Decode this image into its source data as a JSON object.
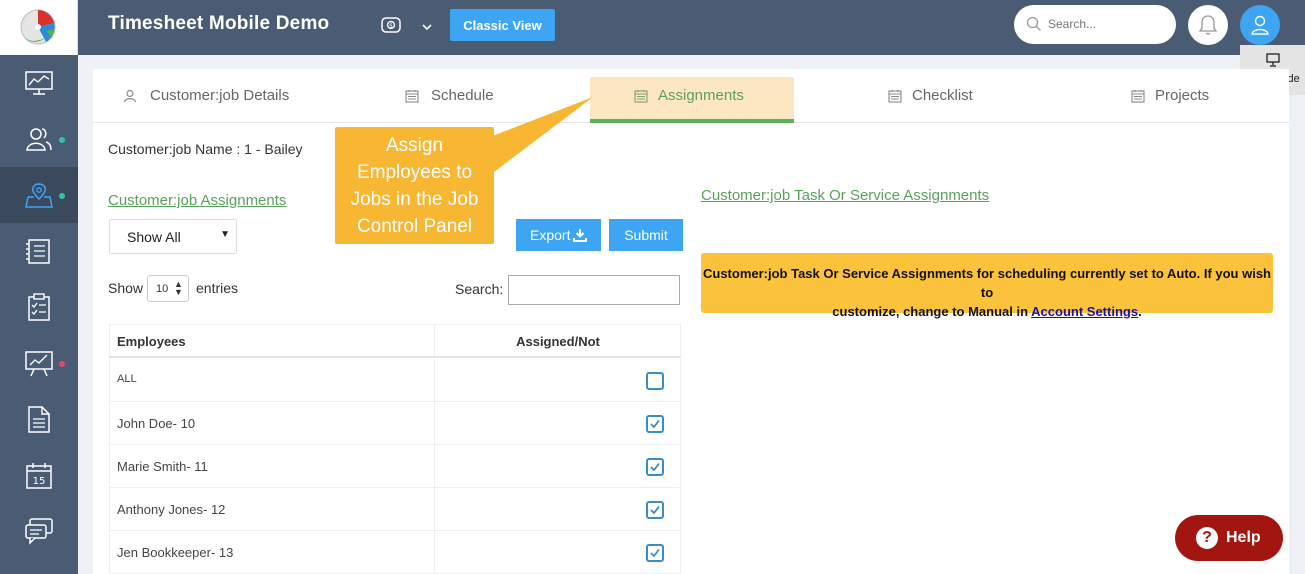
{
  "app": {
    "title": "Timesheet Mobile Demo",
    "classic_view_label": "Classic View",
    "search_placeholder": "Search...",
    "page_guide_label": "page guide",
    "help_label": "Help"
  },
  "sidebar": {
    "items": [
      {
        "icon": "dashboard-monitor-icon",
        "active": false,
        "dot": null
      },
      {
        "icon": "users-icon",
        "active": false,
        "dot": "#2ec4a6"
      },
      {
        "icon": "map-pin-icon",
        "active": true,
        "dot": "#2ec4a6"
      },
      {
        "icon": "timesheet-icon",
        "active": false,
        "dot": null
      },
      {
        "icon": "clipboard-checklist-icon",
        "active": false,
        "dot": null
      },
      {
        "icon": "chart-presentation-icon",
        "active": false,
        "dot": "#e9456b"
      },
      {
        "icon": "document-icon",
        "active": false,
        "dot": null
      },
      {
        "icon": "calendar-icon",
        "active": false,
        "dot": null
      },
      {
        "icon": "chat-icon",
        "active": false,
        "dot": null
      }
    ]
  },
  "tabs": [
    {
      "label": "Customer:job Details",
      "icon": "user-icon",
      "active": false
    },
    {
      "label": "Schedule",
      "icon": "calendar-icon",
      "active": false
    },
    {
      "label": "Assignments",
      "icon": "calendar-icon",
      "active": true
    },
    {
      "label": "Checklist",
      "icon": "calendar-icon",
      "active": false
    },
    {
      "label": "Projects",
      "icon": "calendar-icon",
      "active": false
    }
  ],
  "main": {
    "job_name": "Customer:job Name : 1 - Bailey",
    "assignments_link": "Customer:job Assignments",
    "task_link": "Customer:job Task Or Service Assignments",
    "filter_value": "Show All",
    "export_label": "Export",
    "submit_label": "Submit",
    "show_label": "Show",
    "entries_value": "10",
    "entries_label": "entries",
    "search_label": "Search:",
    "info_text_1": "Customer:job Task Or Service Assignments for scheduling currently set to Auto. If you wish to",
    "info_text_2": "customize, change to Manual in",
    "info_link": "Account Settings",
    "info_text_3": "."
  },
  "table": {
    "headers": [
      "Employees",
      "Assigned/Not"
    ],
    "rows": [
      {
        "name": "ALL",
        "checked": false
      },
      {
        "name": "John Doe- 10",
        "checked": true
      },
      {
        "name": "Marie Smith- 11",
        "checked": true
      },
      {
        "name": "Anthony Jones- 12",
        "checked": true
      },
      {
        "name": "Jen Bookkeeper- 13",
        "checked": true
      }
    ]
  },
  "callout": {
    "lines": [
      "Assign",
      "Employees to",
      "Jobs in the Job",
      "Control Panel"
    ]
  },
  "colors": {
    "topbar": "#4a5c73",
    "accent_blue": "#3da5f4",
    "link_green": "#59a25b",
    "info_yellow": "#fbc23b",
    "help_red": "#a3160f"
  }
}
